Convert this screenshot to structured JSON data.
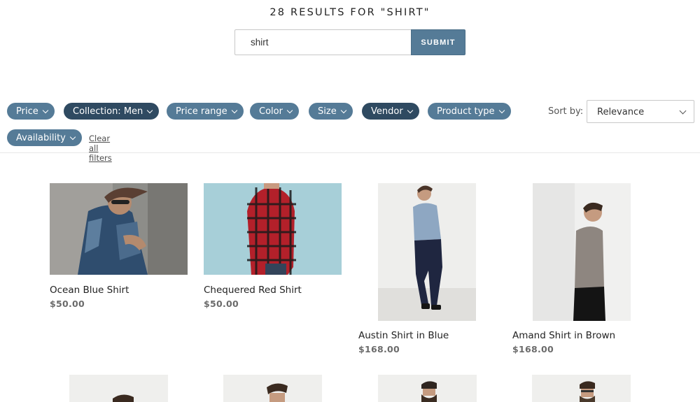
{
  "search": {
    "title": "28 RESULTS FOR \"SHIRT\"",
    "query": "shirt",
    "submit_label": "SUBMIT"
  },
  "filters": {
    "pills": [
      {
        "label": "Price",
        "active": false
      },
      {
        "label": "Collection: Men",
        "active": true
      },
      {
        "label": "Price range",
        "active": false
      },
      {
        "label": "Color",
        "active": false
      },
      {
        "label": "Size",
        "active": false
      },
      {
        "label": "Vendor",
        "active": true
      },
      {
        "label": "Product type",
        "active": false
      },
      {
        "label": "Availability",
        "active": false
      }
    ],
    "clear_label": "Clear all filters"
  },
  "sort": {
    "label": "Sort by:",
    "value": "Relevance"
  },
  "products": [
    {
      "name": "Ocean Blue Shirt",
      "price": "$50.00"
    },
    {
      "name": "Chequered Red Shirt",
      "price": "$50.00"
    },
    {
      "name": "Austin Shirt in Blue",
      "price": "$168.00"
    },
    {
      "name": "Amand Shirt in Brown",
      "price": "$168.00"
    }
  ],
  "colors": {
    "accent": "#557b97",
    "active_pill": "#2f4a61"
  }
}
